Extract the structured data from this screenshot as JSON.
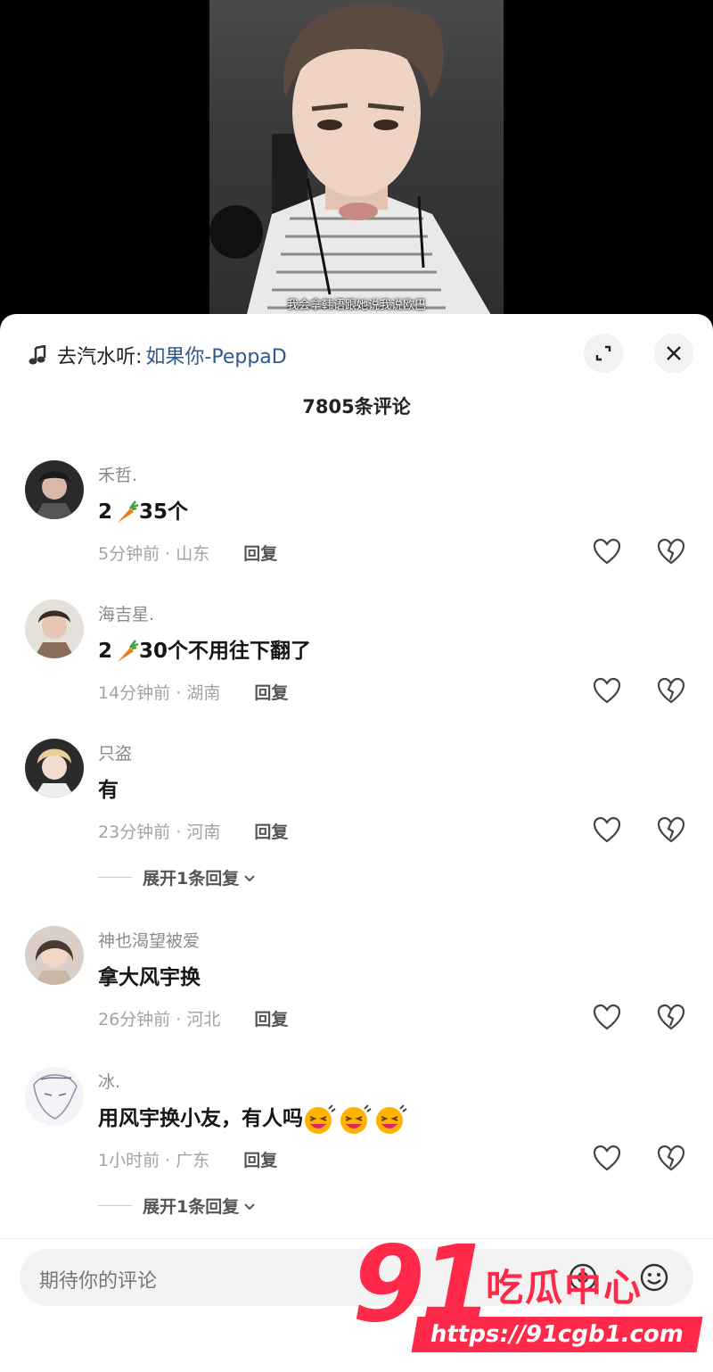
{
  "video": {
    "subtitle": "我会拿韩语跟她说我说欧巴"
  },
  "sheet": {
    "music_prefix": "去汽水听:",
    "music_title": "如果你-PeppaD",
    "comment_count_title": "7805条评论"
  },
  "comments": [
    {
      "username": "禾哲.",
      "text_before": "2",
      "text_after": "35个",
      "has_carrot": true,
      "time": "5分钟前",
      "location": "山东",
      "reply_label": "回复"
    },
    {
      "username": "海吉星.",
      "text_before": "2",
      "text_after": "30个不用往下翻了",
      "has_carrot": true,
      "time": "14分钟前",
      "location": "湖南",
      "reply_label": "回复"
    },
    {
      "username": "只盗",
      "text_before": "有",
      "text_after": "",
      "has_carrot": false,
      "time": "23分钟前",
      "location": "河南",
      "reply_label": "回复",
      "expand_label": "展开1条回复"
    },
    {
      "username": "神也渴望被爱",
      "text_before": "拿大风宇换",
      "text_after": "",
      "has_carrot": false,
      "time": "26分钟前",
      "location": "河北",
      "reply_label": "回复"
    },
    {
      "username": "冰.",
      "text_before": "用风宇换小友，有人吗",
      "text_after": "",
      "has_carrot": false,
      "time": "1小时前",
      "location": "广东",
      "reply_label": "回复",
      "expand_label": "展开1条回复"
    }
  ],
  "input": {
    "placeholder": "期待你的评论"
  },
  "watermark": {
    "logo_number": "91",
    "logo_text": "吃瓜中心",
    "url": "https://91cgb1.com"
  },
  "colors": {
    "link": "#2d5a8a",
    "watermark": "#ff2a4a"
  }
}
